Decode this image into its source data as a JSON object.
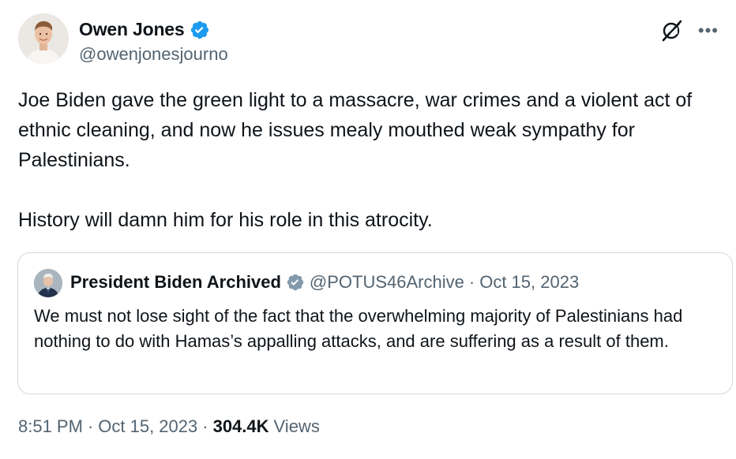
{
  "author": {
    "display_name": "Owen Jones",
    "handle": "@owenjonesjourno"
  },
  "tweet": {
    "text": "Joe Biden gave the green light to a massacre, war crimes and a violent act of ethnic cleaning, and now he issues mealy mouthed weak sympathy for Palestinians.\n\nHistory will damn him for his role in this atrocity."
  },
  "quote": {
    "display_name": "President Biden Archived",
    "handle": "@POTUS46Archive",
    "separator": "·",
    "date": "Oct 15, 2023",
    "text": "We must not lose sight of the fact that the overwhelming majority of Palestinians had nothing to do with Hamas’s appalling attacks, and are suffering as a result of them."
  },
  "footer": {
    "time": "8:51 PM",
    "separator1": "·",
    "date": "Oct 15, 2023",
    "separator2": "·",
    "views_count": "304.4K",
    "views_label": "Views"
  },
  "icons": {
    "verified": "verified-badge-icon",
    "verified_gray": "gray-verified-badge-icon",
    "grok": "grok-icon",
    "more": "more-icon"
  },
  "colors": {
    "text_primary": "#0f1419",
    "text_secondary": "#536471",
    "verified_blue": "#1d9bf0",
    "verified_gray": "#829aab",
    "border": "#cfd9de"
  }
}
